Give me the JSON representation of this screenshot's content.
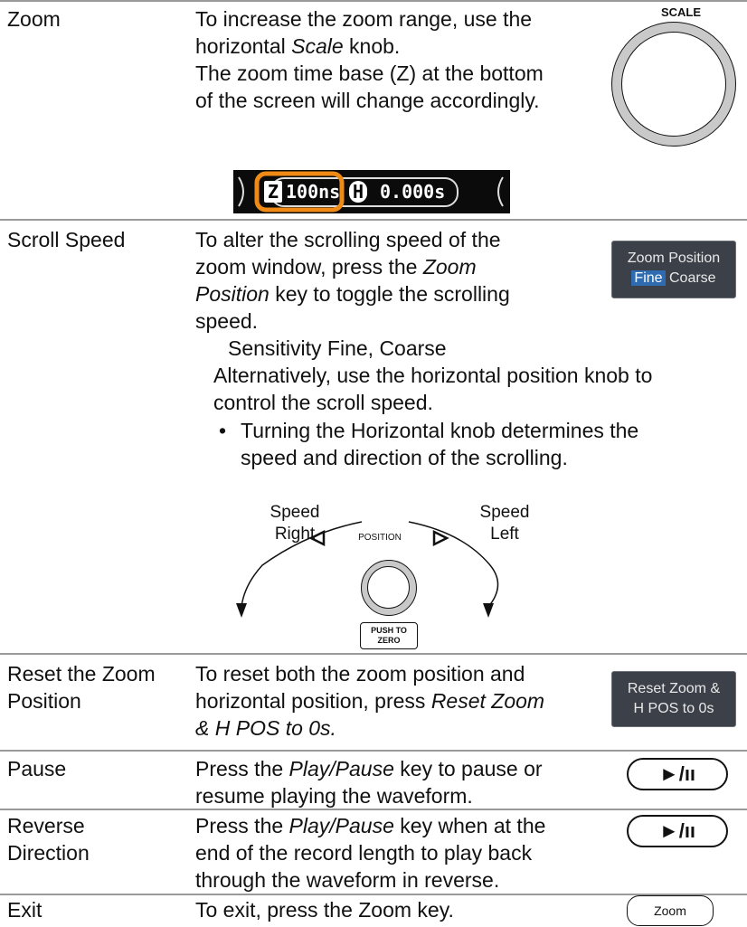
{
  "rows": {
    "zoom": {
      "label": "Zoom",
      "line1": "To increase the zoom range, use the",
      "line2_pre": "horizontal ",
      "line2_em": "Scale",
      "line2_post": " knob.",
      "line3": "The zoom time base (Z) at the bottom",
      "line4": "of the screen will change accordingly.",
      "knob_caption": "SCALE"
    },
    "scroll": {
      "label": "Scroll Speed",
      "line1": "To alter the scrolling speed of the",
      "line2_pre": "zoom window, press the ",
      "line2_em": "Zoom",
      "line3_em": "Position",
      "line3_post": " key to toggle the scrolling",
      "line4": "speed.",
      "sensitivity": "Sensitivity Fine, Coarse",
      "alt1": "Alternatively, use the horizontal position knob to",
      "alt2": "control the scroll speed.",
      "bullet1": "Turning the Horizontal knob determines the",
      "bullet2": "speed and direction of the scrolling."
    },
    "reset": {
      "label1": "Reset the Zoom",
      "label2": "Position",
      "line1": "To reset both the zoom position and",
      "line2_pre": "horizontal position, press ",
      "line2_em": "Reset Zoom",
      "line3_em": "& H POS to 0s."
    },
    "pause": {
      "label": "Pause",
      "line1_pre": "Press the ",
      "line1_em": "Play/Pause",
      "line1_post": " key to pause or",
      "line2": "resume playing the waveform."
    },
    "reverse": {
      "label1": "Reverse",
      "label2": "Direction",
      "line1_pre": "Press the ",
      "line1_em": "Play/Pause",
      "line1_post": " key when at the",
      "line2": "end of the record length to play back",
      "line3": "through the waveform in reverse."
    },
    "exit": {
      "label": "Exit",
      "line1": "To exit, press the Zoom key."
    }
  },
  "status_strip": {
    "z_badge": "Z",
    "z_value": "100ns",
    "h_badge": "H",
    "h_value": "0.000s"
  },
  "softkeys": {
    "zoom_position": {
      "title": "Zoom Position",
      "fine": "Fine",
      "coarse": "Coarse"
    },
    "reset_zoom": {
      "line1": "Reset Zoom &",
      "line2": "H POS to 0s"
    }
  },
  "panel_buttons": {
    "play_pause": "►/ıı",
    "zoom": "Zoom"
  },
  "position_diagram": {
    "speed_right_1": "Speed",
    "speed_right_2": "Right",
    "speed_left_1": "Speed",
    "speed_left_2": "Left",
    "position": "POSITION",
    "push_to": "PUSH TO",
    "zero": "ZERO"
  },
  "colors": {
    "highlight": "#f08a16",
    "softkey_bg": "#3c4049",
    "softkey_selected": "#2e6bb1"
  }
}
